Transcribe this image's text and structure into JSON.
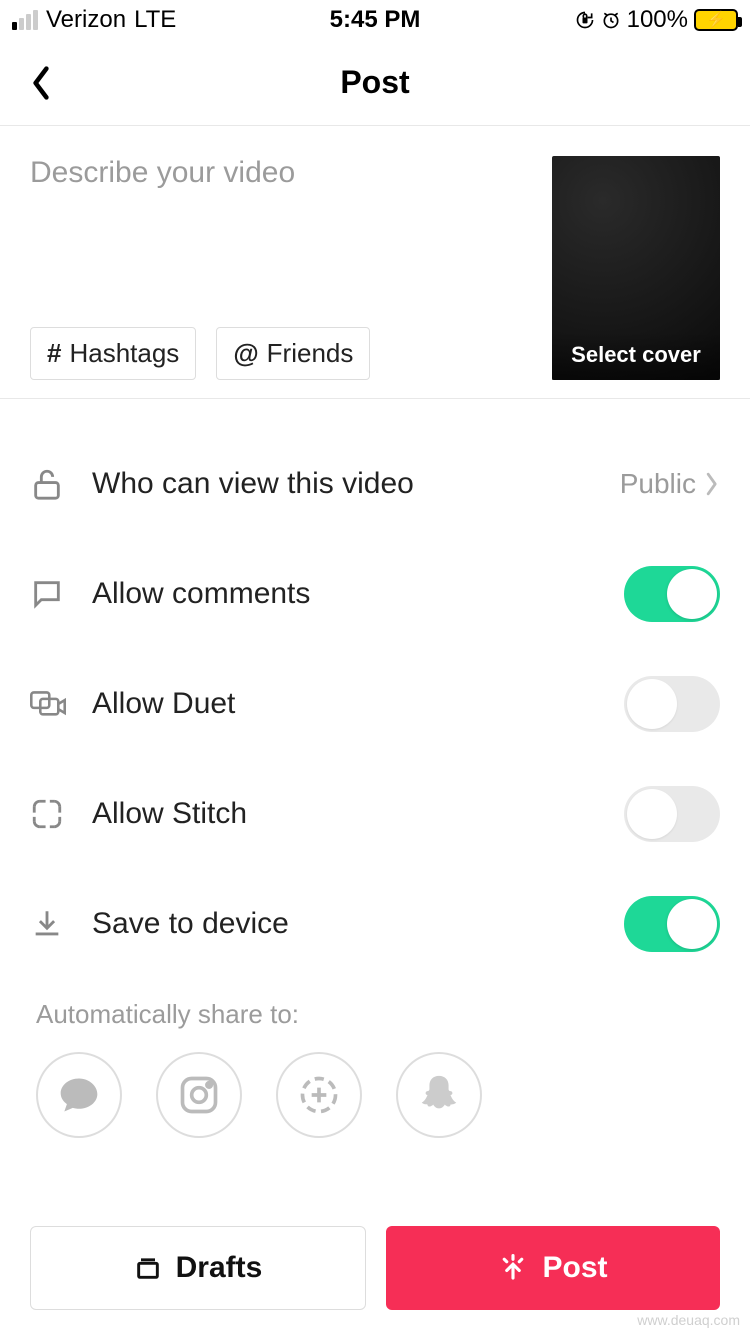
{
  "status": {
    "carrier": "Verizon",
    "network": "LTE",
    "time": "5:45 PM",
    "battery_pct": "100%"
  },
  "header": {
    "title": "Post"
  },
  "compose": {
    "placeholder": "Describe your video",
    "hashtags_label": "Hashtags",
    "friends_label": "Friends",
    "cover_label": "Select cover"
  },
  "settings": {
    "privacy": {
      "label": "Who can view this video",
      "value": "Public"
    },
    "comments": {
      "label": "Allow comments",
      "on": true
    },
    "duet": {
      "label": "Allow Duet",
      "on": false
    },
    "stitch": {
      "label": "Allow Stitch",
      "on": false
    },
    "save": {
      "label": "Save to device",
      "on": true
    }
  },
  "share": {
    "label": "Automatically share to:"
  },
  "bottom": {
    "drafts": "Drafts",
    "post": "Post"
  },
  "watermark": "www.deuaq.com"
}
